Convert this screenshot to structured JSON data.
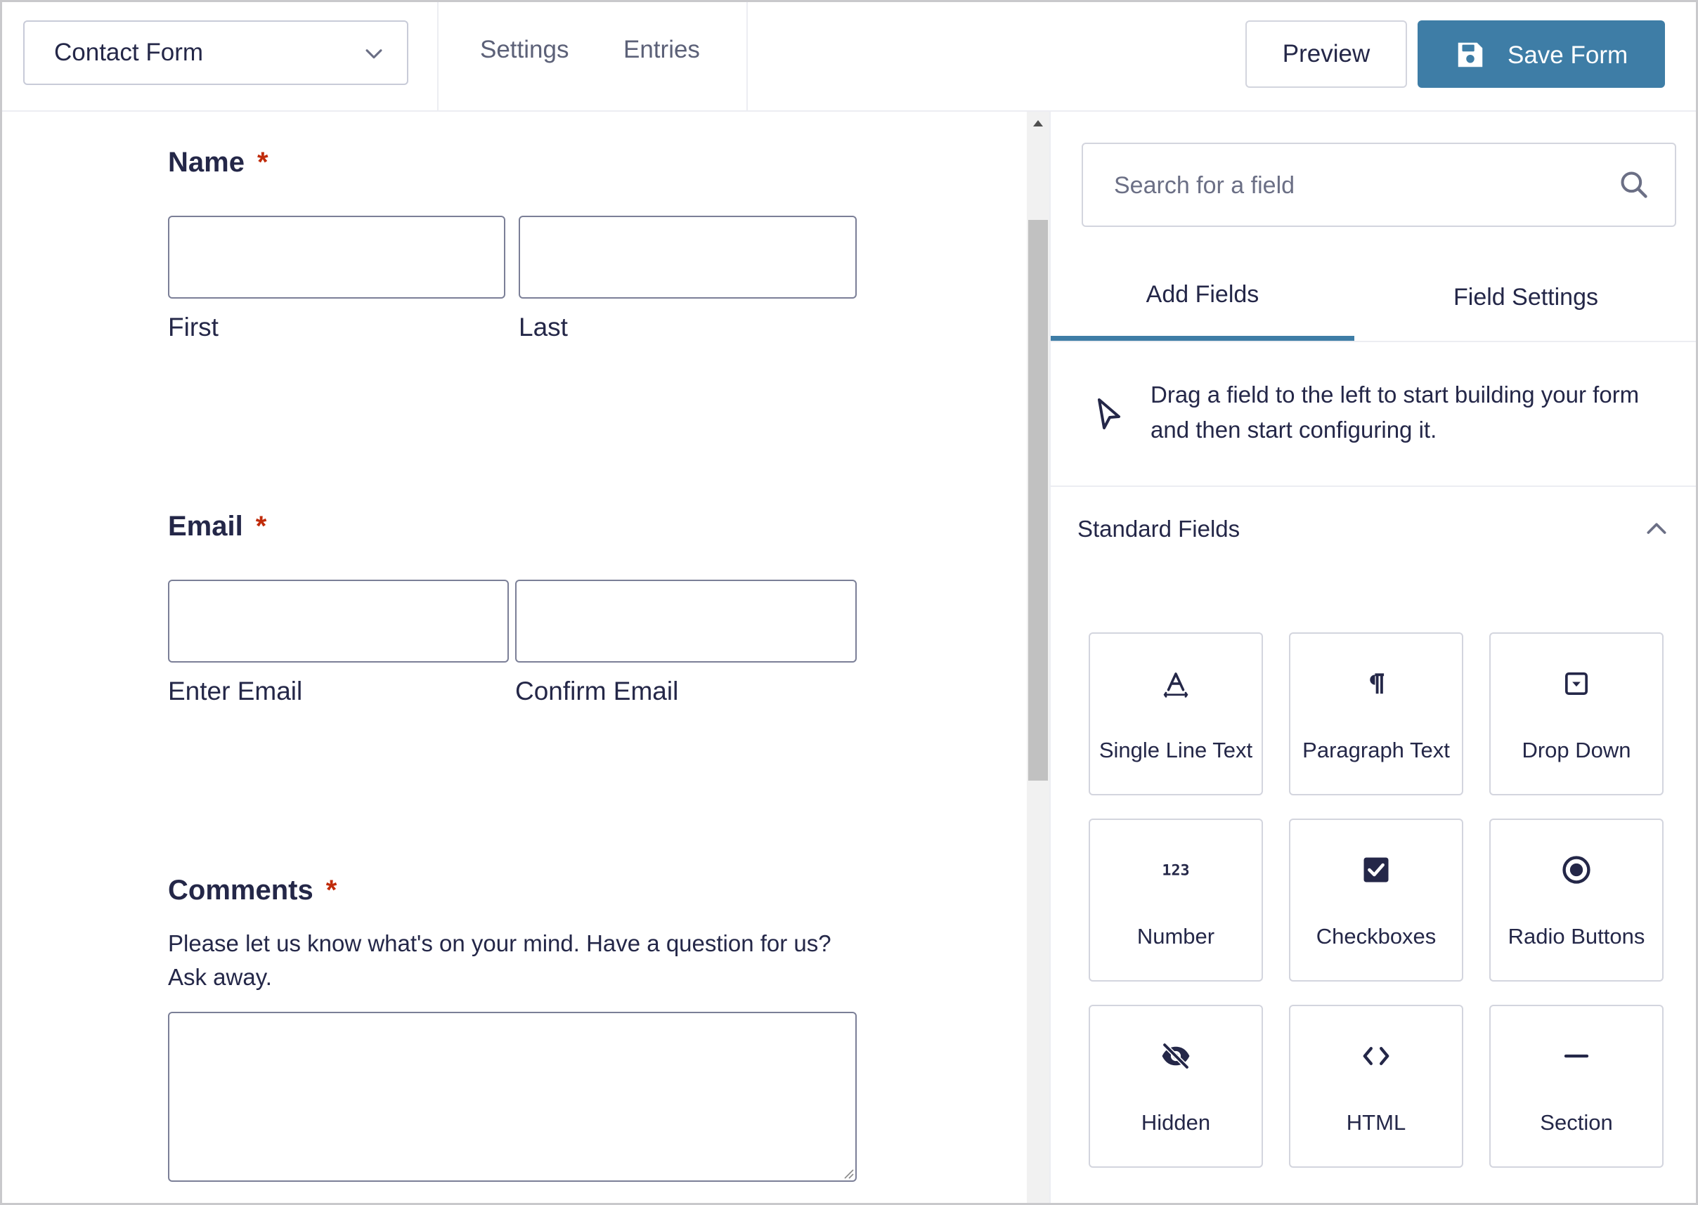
{
  "topbar": {
    "form_name": "Contact Form",
    "links": [
      "Settings",
      "Entries"
    ],
    "preview_label": "Preview",
    "save_label": "Save Form"
  },
  "form": {
    "name": {
      "label": "Name",
      "required_mark": "*",
      "sublabels": [
        "First",
        "Last"
      ]
    },
    "email": {
      "label": "Email",
      "required_mark": "*",
      "sublabels": [
        "Enter Email",
        "Confirm Email"
      ]
    },
    "comments": {
      "label": "Comments",
      "required_mark": "*",
      "description": "Please let us know what's on your mind. Have a question for us? Ask away."
    }
  },
  "panel": {
    "search_placeholder": "Search for a field",
    "tabs": [
      {
        "label": "Add Fields",
        "active": true
      },
      {
        "label": "Field Settings",
        "active": false
      }
    ],
    "hint": "Drag a field to the left to start building your form and then start configuring it.",
    "section_title": "Standard Fields",
    "fields": [
      {
        "label": "Single Line Text",
        "icon": "text-icon"
      },
      {
        "label": "Paragraph Text",
        "icon": "paragraph-icon"
      },
      {
        "label": "Drop Down",
        "icon": "dropdown-icon"
      },
      {
        "label": "Number",
        "icon": "number-icon"
      },
      {
        "label": "Checkboxes",
        "icon": "checkbox-icon"
      },
      {
        "label": "Radio Buttons",
        "icon": "radio-icon"
      },
      {
        "label": "Hidden",
        "icon": "eye-off-icon"
      },
      {
        "label": "HTML",
        "icon": "code-icon"
      },
      {
        "label": "Section",
        "icon": "dash-icon"
      }
    ]
  },
  "colors": {
    "accent": "#3e7da6",
    "required": "#c02b0a",
    "text": "#242748"
  }
}
